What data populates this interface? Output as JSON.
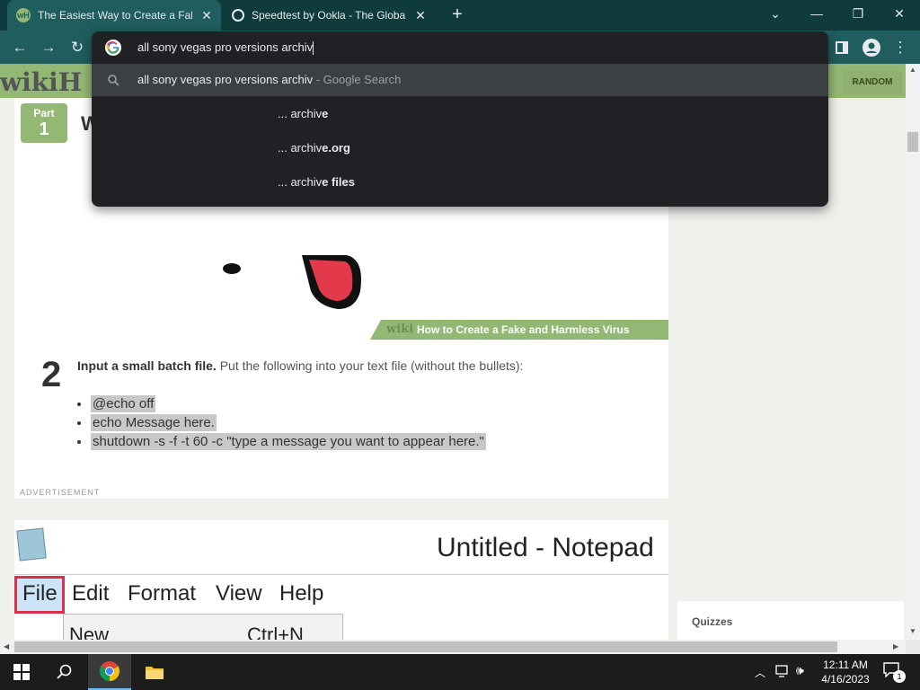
{
  "tabs": [
    {
      "title": "The Easiest Way to Create a Fake",
      "close": "✕"
    },
    {
      "title": "Speedtest by Ookla - The Global",
      "close": "✕"
    }
  ],
  "new_tab": "+",
  "window_controls": {
    "dropdown": "⌄",
    "minimize": "—",
    "restore": "❐",
    "close": "✕"
  },
  "omnibox": {
    "query": "all sony vegas pro versions archiv",
    "search_text": "all sony vegas pro versions archiv",
    "search_suffix": " - Google Search",
    "suggestions": [
      {
        "prefix": "... archiv",
        "rest": "e"
      },
      {
        "prefix": "... archiv",
        "rest": "e.org"
      },
      {
        "prefix": "... archiv",
        "rest": "e files"
      }
    ]
  },
  "wiki": {
    "logo": "wikiH",
    "random_btn": "RANDOM",
    "part_label": "Part",
    "part_number": "1",
    "heading_partial": "W",
    "watermark_wiki": "wiki",
    "watermark_text": "How to Create a Fake and Harmless Virus",
    "step_number": "2",
    "step_bold": "Input a small batch file.",
    "step_text": " Put the following into your text file (without the bullets):",
    "code_lines": [
      "@echo off",
      "echo Message here.",
      "shutdown -s -f -t 60 -c \"type a message you want to appear here.\""
    ],
    "advertisement": "ADVERTISEMENT",
    "notepad_title": "Untitled - Notepad",
    "notepad_menu": [
      "File",
      "Edit",
      "Format",
      "View",
      "Help"
    ],
    "notepad_item_new": "New",
    "notepad_item_shortcut": "Ctrl+N",
    "quizzes": "Quizzes"
  },
  "taskbar": {
    "time": "12:11 AM",
    "date": "4/16/2023",
    "notification_count": "1"
  },
  "colors": {
    "tab_strip": "#0f3b3c",
    "toolbar": "#1f5d5e",
    "omnibox_bg": "#202124",
    "wiki_green": "#93b874"
  }
}
